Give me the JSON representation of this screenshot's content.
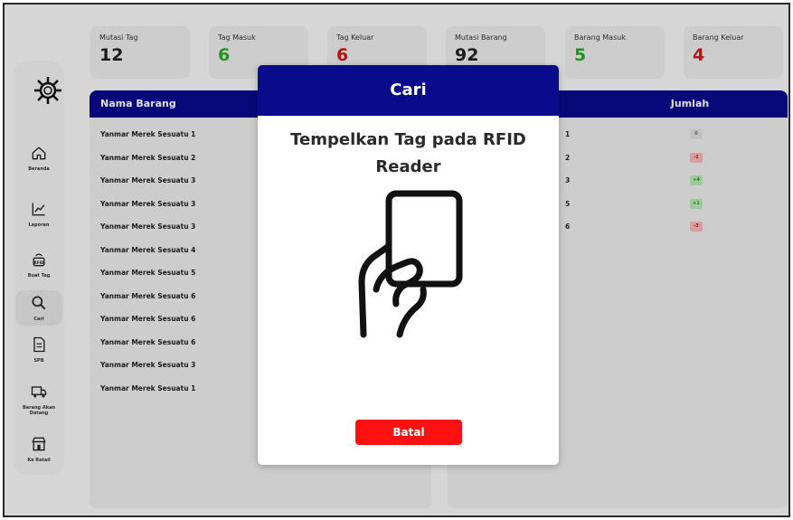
{
  "stats": [
    {
      "label": "Mutasi Tag",
      "value": "12",
      "color": "#222222"
    },
    {
      "label": "Tag Masuk",
      "value": "6",
      "color": "#2aa52a"
    },
    {
      "label": "Tag Keluar",
      "value": "6",
      "color": "#d01818"
    },
    {
      "label": "Mutasi Barang",
      "value": "92",
      "color": "#222222"
    },
    {
      "label": "Barang Masuk",
      "value": "5",
      "color": "#2aa52a"
    },
    {
      "label": "Barang Keluar",
      "value": "4",
      "color": "#d01818"
    }
  ],
  "sidebar": {
    "items": [
      {
        "label": "Beranda",
        "icon": "home-icon"
      },
      {
        "label": "Laporan",
        "icon": "chart-icon"
      },
      {
        "label": "Buat Tag",
        "icon": "rfid-icon"
      },
      {
        "label": "Cari",
        "icon": "search-icon"
      },
      {
        "label": "SPB",
        "icon": "document-icon"
      },
      {
        "label": "Barang Akan Datang",
        "icon": "truck-icon"
      },
      {
        "label": "Ke Retail",
        "icon": "store-icon"
      }
    ]
  },
  "table_left": {
    "header": "Nama Barang",
    "rows": [
      "Yanmar Merek Sesuatu 1",
      "Yanmar Merek Sesuatu 2",
      "Yanmar Merek Sesuatu 3",
      "Yanmar Merek Sesuatu 3",
      "Yanmar Merek Sesuatu 3",
      "Yanmar Merek Sesuatu 4",
      "Yanmar Merek Sesuatu 5",
      "Yanmar Merek Sesuatu 6",
      "Yanmar Merek Sesuatu 6",
      "Yanmar Merek Sesuatu 6",
      "Yanmar Merek Sesuatu 3",
      "Yanmar Merek Sesuatu 1"
    ]
  },
  "table_right": {
    "header": "Jumlah",
    "rows": [
      {
        "num": "1",
        "badge": "0",
        "kind": "neutral"
      },
      {
        "num": "2",
        "badge": "-1",
        "kind": "neg"
      },
      {
        "num": "3",
        "badge": "+4",
        "kind": "pos"
      },
      {
        "num": "5",
        "badge": "+1",
        "kind": "pos"
      },
      {
        "num": "6",
        "badge": "-3",
        "kind": "neg"
      }
    ]
  },
  "modal": {
    "title": "Cari",
    "message": "Tempelkan Tag pada RFID Reader",
    "cancel_label": "Batal"
  }
}
